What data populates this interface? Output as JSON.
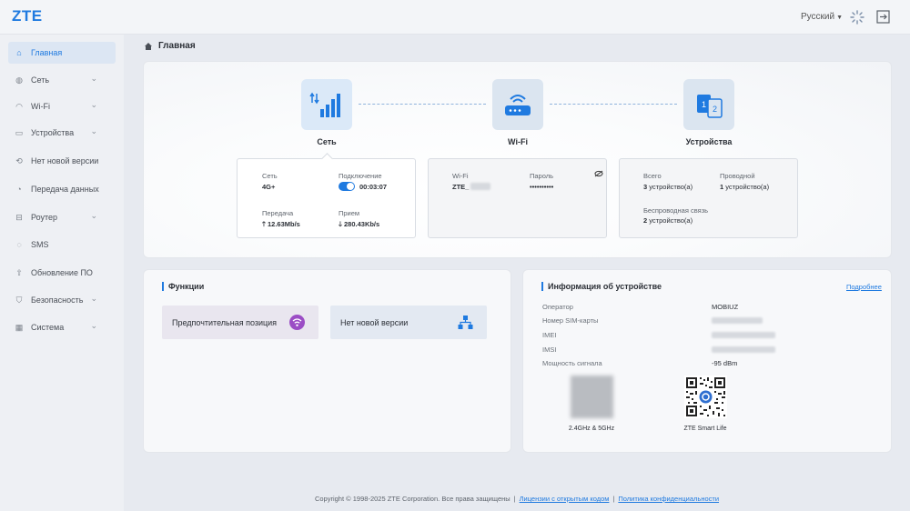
{
  "header": {
    "logo": "ZTE",
    "language": "Русский"
  },
  "sidebar": {
    "items": [
      {
        "label": "Главная",
        "icon": "home-icon",
        "active": true
      },
      {
        "label": "Сеть",
        "icon": "globe-icon",
        "expandable": true
      },
      {
        "label": "Wi-Fi",
        "icon": "wifi-icon",
        "expandable": true
      },
      {
        "label": "Устройства",
        "icon": "devices-icon",
        "expandable": true
      },
      {
        "label": "Нет новой версии",
        "icon": "update-icon"
      },
      {
        "label": "Передача данных",
        "icon": "data-icon"
      },
      {
        "label": "Роутер",
        "icon": "router-icon",
        "expandable": true
      },
      {
        "label": "SMS",
        "icon": "sms-icon"
      },
      {
        "label": "Обновление ПО",
        "icon": "upgrade-icon"
      },
      {
        "label": "Безопасность",
        "icon": "shield-icon",
        "expandable": true
      },
      {
        "label": "Система",
        "icon": "system-icon",
        "expandable": true
      }
    ]
  },
  "breadcrumb": {
    "title": "Главная"
  },
  "overview": {
    "network": {
      "label": "Сеть",
      "net_label": "Сеть",
      "net_value": "4G+",
      "conn_label": "Подключение",
      "conn_time": "00:03:07",
      "tx_label": "Передача",
      "tx_value": "12.63Mb/s",
      "rx_label": "Прием",
      "rx_value": "280.43Kb/s"
    },
    "wifi": {
      "label": "Wi-Fi",
      "ssid_label": "Wi-Fi",
      "ssid_value": "ZTE_",
      "pass_label": "Пароль",
      "pass_value": "••••••••••"
    },
    "devices": {
      "label": "Устройства",
      "total_label": "Всего",
      "total_count": "3",
      "total_unit": "устройство(а)",
      "wired_label": "Проводной",
      "wired_count": "1",
      "wired_unit": "устройство(а)",
      "wireless_label": "Беспроводная связь",
      "wireless_count": "2",
      "wireless_unit": "устройство(а)"
    }
  },
  "functions": {
    "title": "Функции",
    "items": [
      {
        "label": "Предпочтительная позиция",
        "icon": "wifi-signal-icon"
      },
      {
        "label": "Нет новой версии",
        "icon": "network-tree-icon"
      }
    ]
  },
  "device_info": {
    "title": "Информация об устройстве",
    "more": "Подробнее",
    "operator_label": "Оператор",
    "operator_value": "MOBIUZ",
    "sim_label": "Номер SIM-карты",
    "imei_label": "IMEI",
    "imsi_label": "IMSI",
    "signal_label": "Мощность сигнала",
    "signal_value": "-95 dBm",
    "qr1_caption": "2.4GHz & 5GHz",
    "qr2_caption": "ZTE Smart Life"
  },
  "footer": {
    "copyright": "Copyright © 1998-2025 ZTE Corporation. Все права защищены",
    "link1": "Лицензии с открытым кодом",
    "link2": "Политика конфиденциальности"
  },
  "colors": {
    "accent": "#1f7ae0",
    "background": "#e7eaf0"
  }
}
